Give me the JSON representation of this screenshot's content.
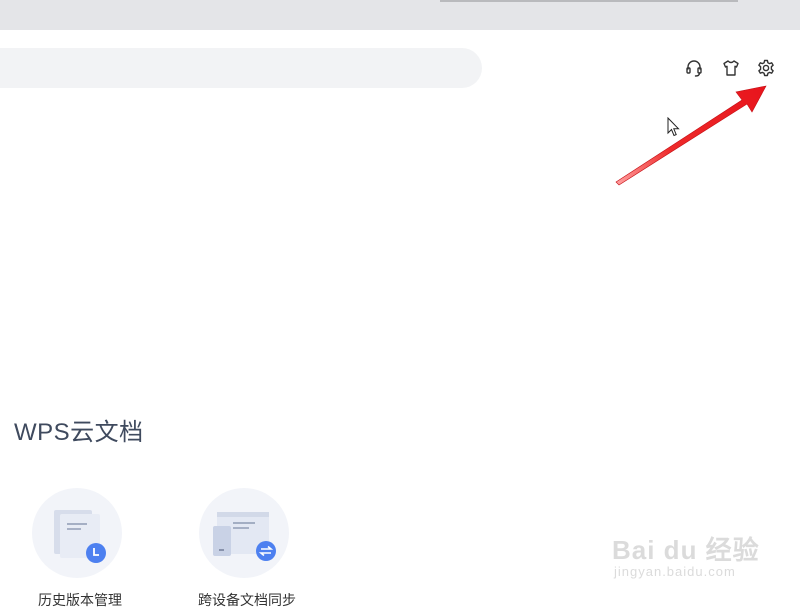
{
  "header": {
    "search_placeholder": "",
    "icons": [
      "headset-icon",
      "skin-shirt-icon",
      "settings-gear-icon"
    ]
  },
  "cloud_section": {
    "title": "WPS云文档",
    "features": [
      {
        "label": "历史版本管理",
        "icon": "history-version-icon",
        "badge_icon": "clock-icon"
      },
      {
        "label": "跨设备文档同步",
        "icon": "cross-device-sync-icon",
        "badge_icon": "sync-arrows-icon"
      }
    ]
  },
  "annotation": {
    "arrow_color": "#e8141c",
    "points_to": "settings-gear-icon"
  },
  "watermark": {
    "text": "Bai du 经验",
    "sub": "jingyan.baidu.com"
  },
  "colors": {
    "accent_blue": "#4d80f0",
    "title_color": "#3f4a5e"
  }
}
